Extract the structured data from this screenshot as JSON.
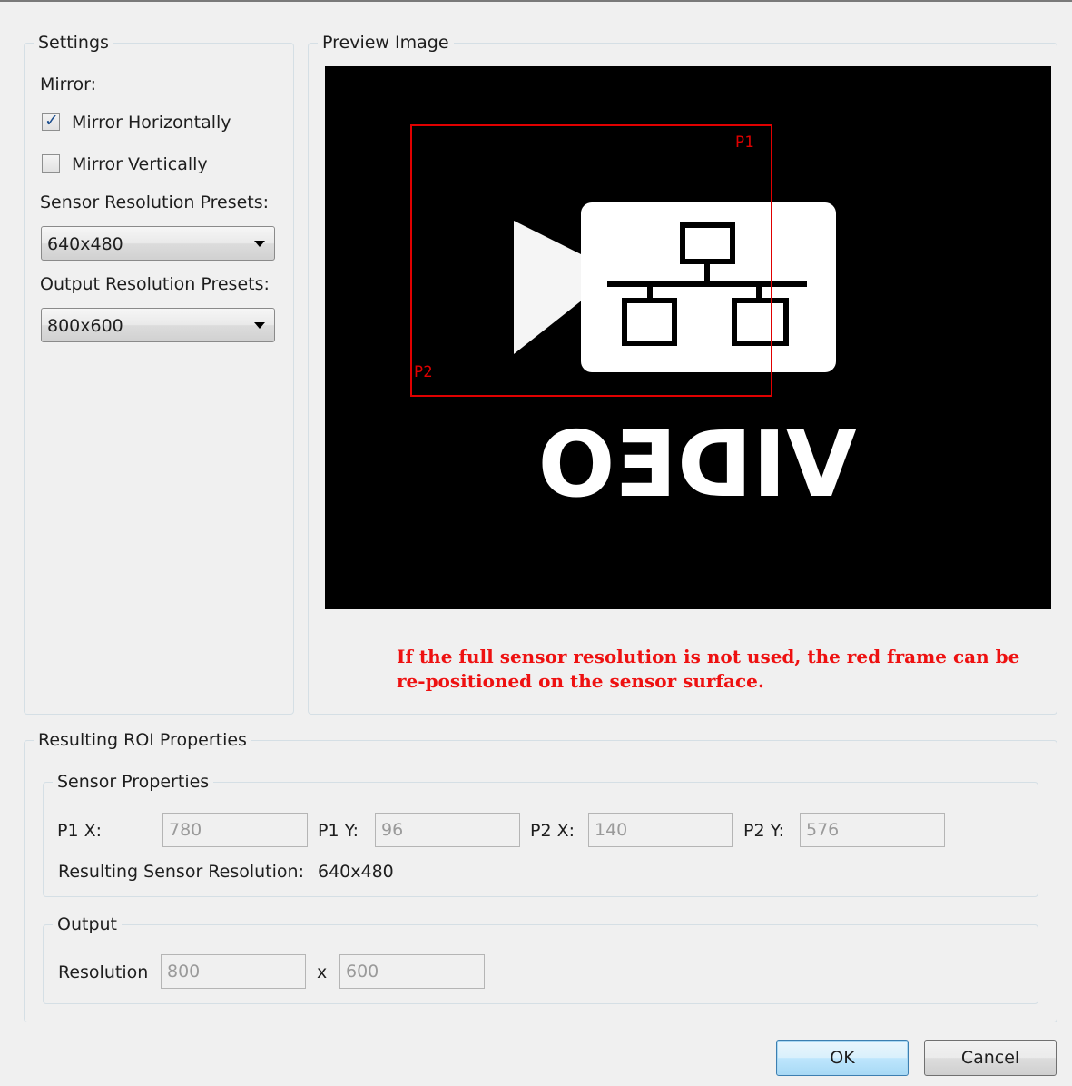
{
  "settings": {
    "title": "Settings",
    "mirror_label": "Mirror:",
    "mirror_horizontal": {
      "label": "Mirror Horizontally",
      "checked": true
    },
    "mirror_vertical": {
      "label": "Mirror Vertically",
      "checked": false
    },
    "sensor_presets_label": "Sensor Resolution Presets:",
    "sensor_preset_value": "640x480",
    "output_presets_label": "Output Resolution Presets:",
    "output_preset_value": "800x600"
  },
  "preview": {
    "title": "Preview Image",
    "roi_p1_label": "P1",
    "roi_p2_label": "P2",
    "logo_text": "VIDEO",
    "note": "If the full sensor resolution is not used, the red frame can be\nre-positioned on the sensor surface."
  },
  "roi": {
    "title": "Resulting ROI Properties",
    "sensor": {
      "title": "Sensor Properties",
      "p1x_label": "P1 X:",
      "p1x": "780",
      "p1y_label": "P1 Y:",
      "p1y": "96",
      "p2x_label": "P2 X:",
      "p2x": "140",
      "p2y_label": "P2 Y:",
      "p2y": "576",
      "resulting_label": "Resulting Sensor Resolution:",
      "resulting_value": "640x480"
    },
    "output": {
      "title": "Output",
      "resolution_label": "Resolution",
      "width": "800",
      "x_label": "x",
      "height": "600"
    }
  },
  "buttons": {
    "ok": "OK",
    "cancel": "Cancel"
  },
  "colors": {
    "frame": "#e00000",
    "note": "#ee1111",
    "preview_bg": "#000000"
  }
}
